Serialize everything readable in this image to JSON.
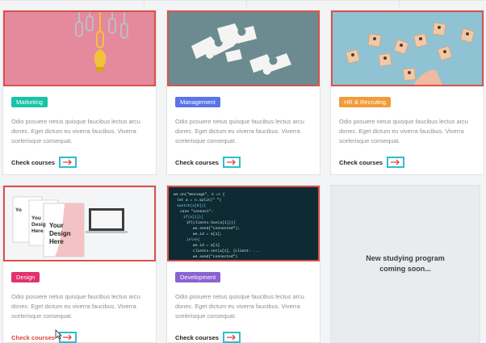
{
  "cards": [
    {
      "tag": "Marketing",
      "tag_color": "#19c3a5",
      "desc": "Odio posuere netus quisque faucibus lectus arcu donec. Eget dictum eu viverra faucibus. Viverra scelerisque consequat.",
      "cta": "Check courses",
      "cta_color": "#1d1f23",
      "image": "paperclips-lightbulb"
    },
    {
      "tag": "Management",
      "tag_color": "#5a74e8",
      "desc": "Odio posuere netus quisque faucibus lectus arcu donec. Eget dictum eu viverra faucibus. Viverra scelerisque consequat.",
      "cta": "Check courses",
      "cta_color": "#1d1f23",
      "image": "puzzle-pieces"
    },
    {
      "tag": "HR & Recruting",
      "tag_color": "#f29b3a",
      "desc": "Odio posuere netus quisque faucibus lectus arcu donec. Eget dictum eu viverra faucibus. Viverra scelerisque consequat.",
      "cta": "Check courses",
      "cta_color": "#1d1f23",
      "image": "people-blocks"
    },
    {
      "tag": "Design",
      "tag_color": "#e0326f",
      "desc": "Odio posuere netus quisque faucibus lectus arcu donec. Eget dictum eu viverra faucibus. Viverra scelerisque consequat.",
      "cta": "Check courses",
      "cta_color": "#e0453a",
      "image": "design-mockups",
      "mockup_text": "Your Design Here"
    },
    {
      "tag": "Development",
      "tag_color": "#8a63d2",
      "desc": "Odio posuere netus quisque faucibus lectus arcu donec. Eget dictum eu viverra faucibus. Viverra scelerisque consequat.",
      "cta": "Check courses",
      "cta_color": "#1d1f23",
      "image": "code-screen"
    }
  ],
  "coming_soon": {
    "line1": "New studying program",
    "line2": "coming soon..."
  },
  "colors": {
    "highlight_border": "#d9534a",
    "arrow_box": "#2bbfd0",
    "arrow": "#e0453a"
  }
}
